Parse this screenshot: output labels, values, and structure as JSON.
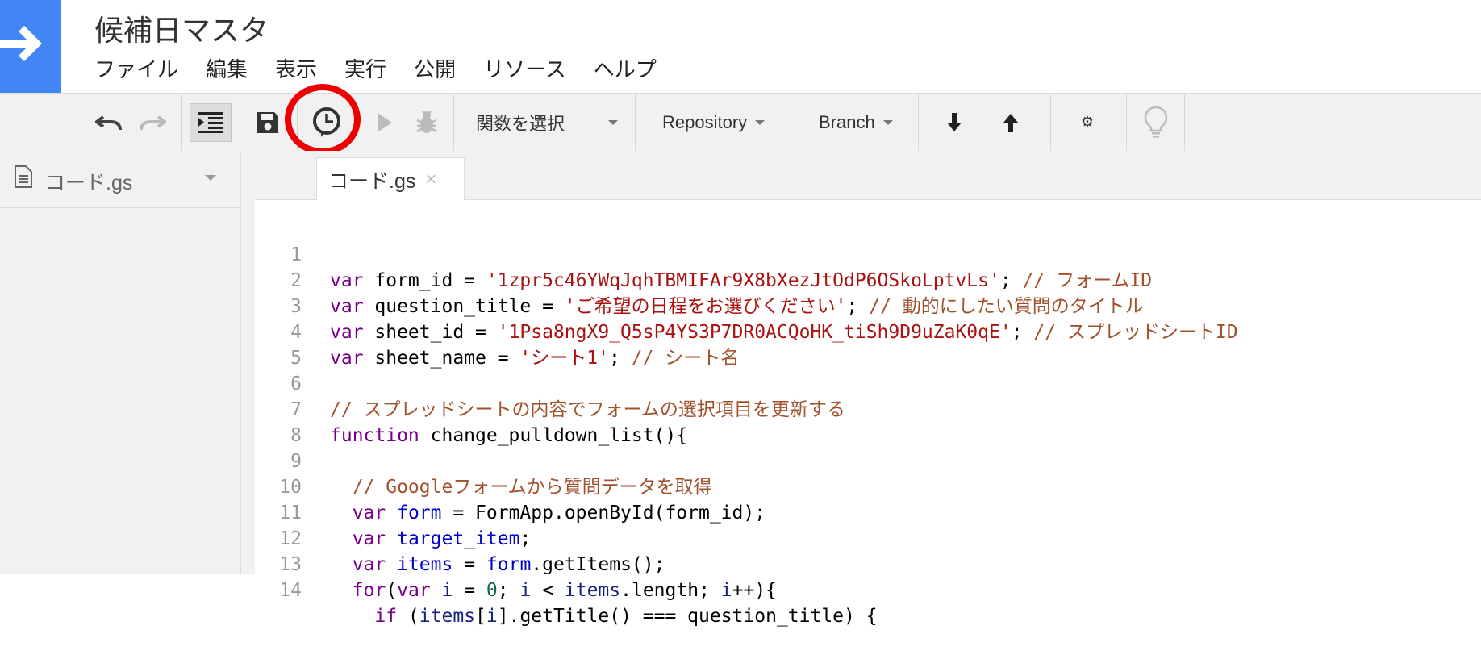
{
  "app": {
    "title": "候補日マスタ"
  },
  "menu": [
    "ファイル",
    "編集",
    "表示",
    "実行",
    "公開",
    "リソース",
    "ヘルプ"
  ],
  "toolbar": {
    "function_select": "関数を選択",
    "repository": "Repository",
    "branch": "Branch",
    "settings_glyph": "⚙"
  },
  "sidebar": {
    "file": "コード.gs"
  },
  "tab": {
    "label": "コード.gs",
    "close": "×"
  },
  "code": {
    "line_numbers": [
      "1",
      "2",
      "3",
      "4",
      "5",
      "6",
      "7",
      "8",
      "9",
      "10",
      "11",
      "12",
      "13",
      "14"
    ],
    "l1": {
      "kw": "var",
      "name": " form_id = ",
      "str": "'1zpr5c46YWqJqhTBMIFAr9X8bXezJtOdP6OSkoLptvLs'",
      "semi": "; ",
      "cm": "// フォームID"
    },
    "l2": {
      "kw": "var",
      "name": " question_title = ",
      "str": "'ご希望の日程をお選びください'",
      "semi": "; ",
      "cm": "// 動的にしたい質問のタイトル"
    },
    "l3": {
      "kw": "var",
      "name": " sheet_id = ",
      "str": "'1Psa8ngX9_Q5sP4YS3P7DR0ACQoHK_tiSh9D9uZaK0qE'",
      "semi": "; ",
      "cm": "// スプレッドシートID"
    },
    "l4": {
      "kw": "var",
      "name": " sheet_name = ",
      "str": "'シート1'",
      "semi": "; ",
      "cm": "// シート名"
    },
    "l6": {
      "cm": "// スプレッドシートの内容でフォームの選択項目を更新する"
    },
    "l7": {
      "kw": "function",
      "rest": " change_pulldown_list(){"
    },
    "l9": {
      "cm": "  // Googleフォームから質問データを取得"
    },
    "l10": {
      "indent": "  ",
      "kw": "var",
      "sp": " ",
      "vr": "form",
      "rest": " = FormApp.openById(form_id);"
    },
    "l11": {
      "indent": "  ",
      "kw": "var",
      "sp": " ",
      "vr": "target_item",
      "rest": ";"
    },
    "l12": {
      "indent": "  ",
      "kw": "var",
      "sp": " ",
      "vr": "items",
      "eq": " = ",
      "vr2": "form",
      "rest": ".getItems();"
    },
    "l13": {
      "indent": "  ",
      "kw": "for",
      "p1": "(",
      "kw2": "var",
      "sp": " ",
      "i1": "i",
      "p2": " = ",
      "n0": "0",
      "p3": "; ",
      "i2": "i",
      "p4": " < ",
      "it": "items",
      "p5": ".length; ",
      "i3": "i",
      "p6": "++){"
    },
    "l14": {
      "indent": "    ",
      "kw": "if",
      "p1": " (",
      "it": "items",
      "p2": "[",
      "i1": "i",
      "p3": "].getTitle() === question_title) {"
    }
  }
}
